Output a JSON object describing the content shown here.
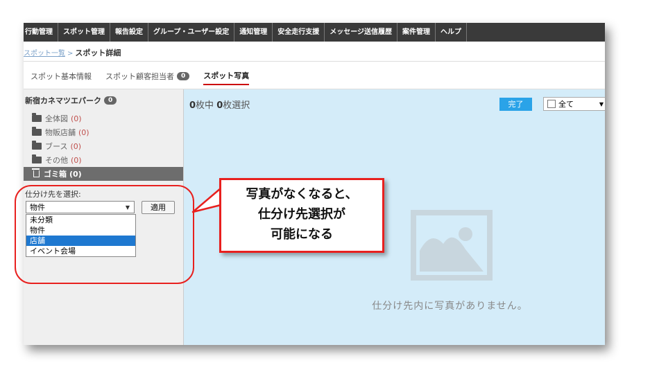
{
  "nav": [
    "行動管理",
    "スポット管理",
    "報告設定",
    "グループ・ユーザー設定",
    "通知管理",
    "安全走行支援",
    "メッセージ送信履歴",
    "案件管理",
    "ヘルプ"
  ],
  "breadcrumb": {
    "parent": "スポット一覧",
    "separator": ">",
    "current": "スポット詳細"
  },
  "tabs": [
    {
      "label": "スポット基本情報"
    },
    {
      "label": "スポット顧客担当者",
      "badge": "0"
    },
    {
      "label": "スポット写真",
      "active": true
    }
  ],
  "sidebar": {
    "spot_name": "新宿カネマツエパーク",
    "spot_count": "0",
    "folders": [
      {
        "label": "全体図",
        "count": "(0)"
      },
      {
        "label": "物販店舗",
        "count": "(0)"
      },
      {
        "label": "ブース",
        "count": "(0)"
      },
      {
        "label": "その他",
        "count": "(0)"
      }
    ],
    "trash": {
      "label": "ゴミ箱",
      "count": "(0)"
    },
    "sort_label": "仕分け先を選択:",
    "select_value": "物件",
    "apply_label": "適用",
    "options": [
      "未分類",
      "物件",
      "店舗",
      "イベント会場"
    ],
    "selected_option": "店舗"
  },
  "main": {
    "count_zero_a": "0",
    "count_text_a": "枚中",
    "count_zero_b": "0",
    "count_text_b": "枚選択",
    "done_label": "完了",
    "all_label": "全て",
    "empty_message": "仕分け先内に写真がありません。"
  },
  "annotation": {
    "line1": "写真がなくなると、",
    "line2": "仕分け先選択が",
    "line3": "可能になる",
    "color": "#e8201e"
  },
  "colors": {
    "nav_bg": "#3a3a3a",
    "panel_bg": "#d4ecf9",
    "sidebar_bg": "#efefef",
    "accent": "#2aa3e8"
  }
}
